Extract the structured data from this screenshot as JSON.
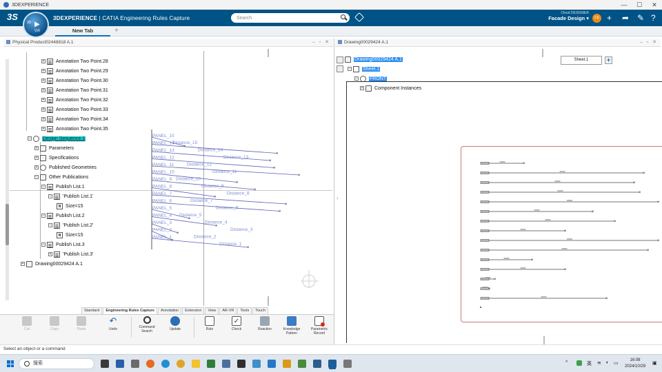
{
  "window": {
    "title": "3DEXPERIENCE"
  },
  "header": {
    "brand_bold": "3DEXPERIENCE",
    "brand_rest": " | CATIA Engineering Rules Capture",
    "compass_version": "V,R",
    "compass_text": "3D",
    "search_placeholder": "Search",
    "role_line1": "Cloud DESIGNER",
    "role_line2": "Facade Design",
    "avatar_initials": "CE",
    "accent": "#005386"
  },
  "tabs": {
    "active": "New Tab",
    "add": "+"
  },
  "left_pane": {
    "title": "Physical Product02448818 A.1",
    "tree": [
      {
        "label": "Annotation Two Point.28",
        "icon": "sheet"
      },
      {
        "label": "Annotation Two Point.29",
        "icon": "sheet"
      },
      {
        "label": "Annotation Two Point.30",
        "icon": "sheet"
      },
      {
        "label": "Annotation Two Point.31",
        "icon": "sheet"
      },
      {
        "label": "Annotation Two Point.32",
        "icon": "sheet"
      },
      {
        "label": "Annotation Two Point.33",
        "icon": "sheet"
      },
      {
        "label": "Annotation Two Point.34",
        "icon": "sheet"
      },
      {
        "label": "Annotation Two Point.35",
        "icon": "sheet"
      },
      {
        "label": "Design Sequence.1",
        "icon": "gear"
      },
      {
        "label": "Parameters",
        "icon": "folder"
      },
      {
        "label": "Specifications",
        "icon": "folder"
      },
      {
        "label": "Published Geometries",
        "icon": "gear"
      },
      {
        "label": "Other Publications",
        "icon": "folder"
      },
      {
        "label": "Publish List.1",
        "icon": "sheet"
      },
      {
        "label": "'Publish List.1'",
        "icon": "sheet"
      },
      {
        "label": "Size=15",
        "icon": "nbox"
      },
      {
        "label": "Publish List.2",
        "icon": "sheet"
      },
      {
        "label": "'Publish List.2'",
        "icon": "sheet"
      },
      {
        "label": "Size=15",
        "icon": "nbox"
      },
      {
        "label": "Publish List.3",
        "icon": "sheet"
      },
      {
        "label": "'Publish List.3'",
        "icon": "sheet"
      },
      {
        "label": "Drawing00029424 A.1",
        "icon": "folder"
      }
    ],
    "overlay_labels": [
      "PANEL_15",
      "Distance_15",
      "PANEL_14",
      "Distance_14",
      "PANEL_13",
      "Distance_13",
      "PANEL_12",
      "Distance_12",
      "PANEL_11",
      "Distance_11",
      "PANEL_10",
      "Distance_10",
      "PANEL_9",
      "Distance_9",
      "PANEL_8",
      "Distance_8",
      "PANEL_7",
      "Distance_7",
      "PANEL_6",
      "Distance_6",
      "PANEL_5",
      "Distance_5",
      "PANEL_4",
      "Distance_4",
      "PANEL_3",
      "Distance_3",
      "PANEL_2",
      "Distance_2",
      "PANEL_1",
      "Distance_1"
    ]
  },
  "ribbon": {
    "tabs": [
      "Standard",
      "Engineering Rules Capture",
      "Annotation",
      "Extension",
      "View",
      "AR-VR",
      "Tools",
      "Touch"
    ],
    "active_tab": "Engineering Rules Capture",
    "commands": [
      {
        "label": "Cut",
        "icon": "scissors-icon",
        "enabled": false
      },
      {
        "label": "Copy",
        "icon": "copy-icon",
        "enabled": false
      },
      {
        "label": "Paste",
        "icon": "paste-icon",
        "enabled": false
      },
      {
        "label": "Undo",
        "icon": "undo-icon",
        "enabled": true
      },
      {
        "label": "Command Search",
        "icon": "magnifier-icon",
        "enabled": true
      },
      {
        "label": "Update",
        "icon": "update-icon",
        "enabled": true
      },
      {
        "label": "Rule",
        "icon": "rule-icon",
        "enabled": true
      },
      {
        "label": "Check",
        "icon": "check-icon",
        "enabled": true
      },
      {
        "label": "Reaction",
        "icon": "reaction-icon",
        "enabled": true
      },
      {
        "label": "Knowledge Pattern",
        "icon": "pattern-icon",
        "enabled": true
      },
      {
        "label": "Parametric Record",
        "icon": "record-icon",
        "enabled": true
      }
    ]
  },
  "right_pane": {
    "title": "Drawing00029424 A.1",
    "tree": [
      {
        "label": "Drawing00029424 A.1"
      },
      {
        "label": "Sheet.1"
      },
      {
        "label": "FRONT"
      },
      {
        "label": "Component Instances"
      }
    ],
    "sheet_field": "Sheet.1",
    "add_sheet": "+"
  },
  "statusbar": {
    "text": "Select an object or a command"
  },
  "taskbar": {
    "search_label": "搜索",
    "ime": "英",
    "time": "16:08",
    "date": "2024/10/29"
  }
}
